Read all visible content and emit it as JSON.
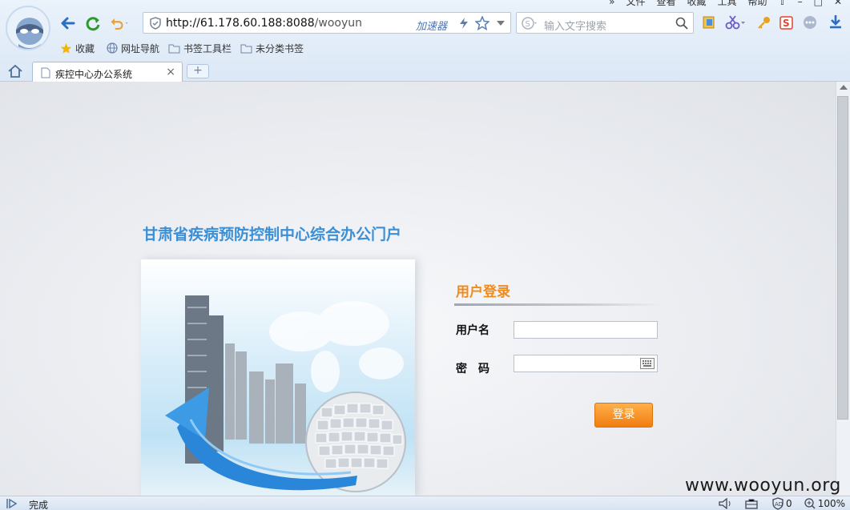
{
  "menu": [
    "文件",
    "查看",
    "收藏",
    "工具",
    "帮助"
  ],
  "address_bar": {
    "host": "http://61.178.60.188:8088",
    "path": "/wooyun",
    "accelerator": "加速器"
  },
  "search": {
    "placeholder": "输入文字搜索"
  },
  "bookmarks": [
    "收藏",
    "网址导航",
    "书签工具栏",
    "未分类书签"
  ],
  "tab": {
    "title": "疾控中心办公系统",
    "new_tab": "+"
  },
  "page": {
    "portal_title": "甘肃省疾病预防控制中心综合办公门户",
    "login_title": "用户登录",
    "username_label": "用户名",
    "password_label": "密　码",
    "username_value": "",
    "password_value": "",
    "login_button": "登录"
  },
  "status": {
    "text": "完成",
    "blocked_count": "0",
    "zoom": "100%"
  },
  "watermark": "www.wooyun.org",
  "colors": {
    "portal_title": "#3b8fd6",
    "login_title": "#f08a1d",
    "login_button": "#f5901f"
  }
}
